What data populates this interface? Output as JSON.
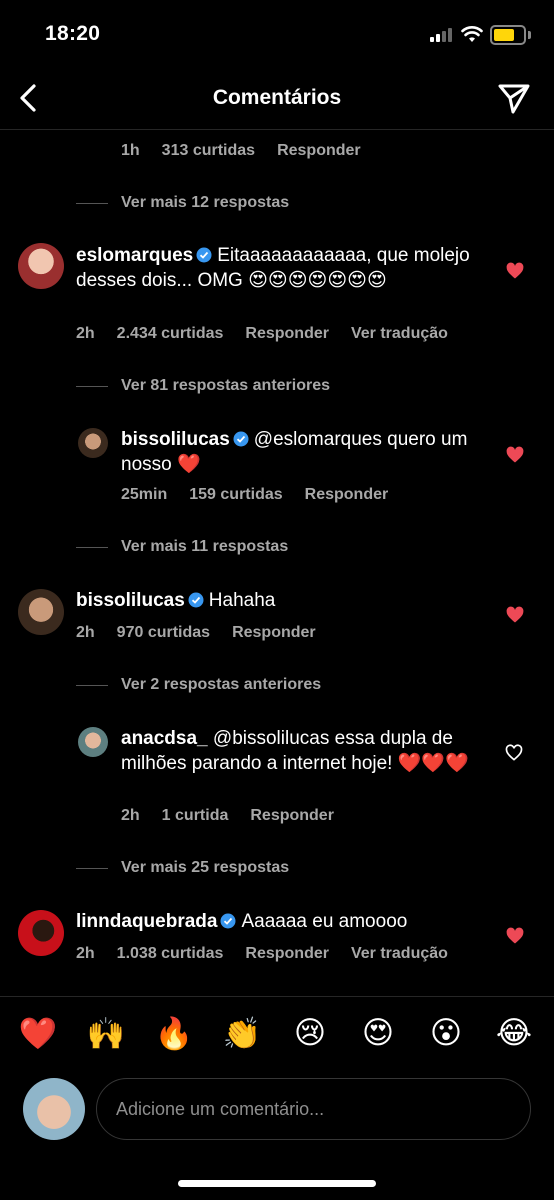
{
  "status_bar": {
    "time": "18:20"
  },
  "header": {
    "title": "Comentários"
  },
  "top_meta": {
    "time": "1h",
    "likes": "313 curtidas",
    "reply": "Responder"
  },
  "threads": [
    {
      "more": "Ver mais 12 respostas"
    },
    {
      "more": "Ver 81 respostas anteriores"
    },
    {
      "more": "Ver mais 11 respostas"
    },
    {
      "more": "Ver 2 respostas anteriores"
    },
    {
      "more": "Ver mais 25 respostas"
    }
  ],
  "comments": [
    {
      "username": "eslomarques",
      "text": "Eitaaaaaaaaaaaa, que molejo desses dois... OMG",
      "emojis": "😍😍😍😍😍😍😍",
      "time": "2h",
      "likes": "2.434 curtidas",
      "reply": "Responder",
      "translate": "Ver tradução",
      "liked": true
    },
    {
      "username": "bissolilucas",
      "text": "@eslomarques quero um nosso",
      "emojis": "❤️",
      "time": "25min",
      "likes": "159 curtidas",
      "reply": "Responder",
      "liked": true
    },
    {
      "username": "bissolilucas",
      "text": "Hahaha",
      "time": "2h",
      "likes": "970 curtidas",
      "reply": "Responder",
      "liked": true
    },
    {
      "username": "anacdsa_",
      "text": "@bissolilucas essa dupla de milhões parando a internet hoje!",
      "emojis": "❤️❤️❤️",
      "time": "2h",
      "likes": "1 curtida",
      "reply": "Responder",
      "liked": false
    },
    {
      "username": "linndaquebrada",
      "text": "Aaaaaa eu amoooo",
      "time": "2h",
      "likes": "1.038 curtidas",
      "reply": "Responder",
      "translate": "Ver tradução",
      "liked": true
    }
  ],
  "quick_emojis": [
    "❤️",
    "🙌",
    "🔥",
    "👏",
    "😢",
    "😍",
    "😮",
    "😂"
  ],
  "composer": {
    "placeholder": "Adicione um comentário..."
  },
  "colors": {
    "background": "#000000",
    "like_red": "#ed4956",
    "verified_blue": "#3897f0",
    "meta_gray": "#a8a8a8"
  }
}
